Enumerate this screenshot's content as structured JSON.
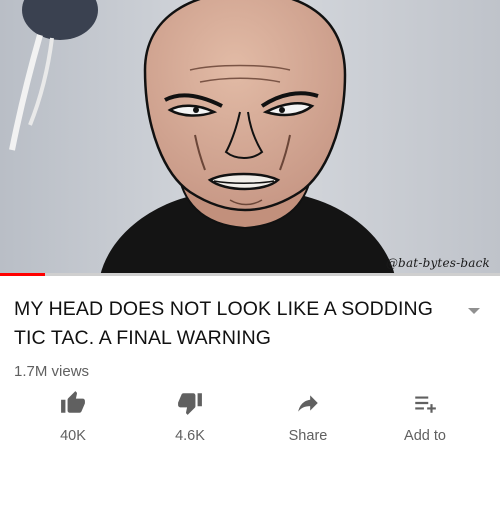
{
  "video": {
    "watermark": "@bat-bytes-back",
    "progress_fraction": 0.09
  },
  "title": "MY HEAD DOES NOT LOOK LIKE A SODDING TIC TAC. A FINAL WARNING",
  "views": "1.7M views",
  "actions": [
    {
      "icon": "thumb-up-icon",
      "label": "40K"
    },
    {
      "icon": "thumb-down-icon",
      "label": "4.6K"
    },
    {
      "icon": "share-icon",
      "label": "Share"
    },
    {
      "icon": "add-to-playlist-icon",
      "label": "Add to"
    }
  ],
  "colors": {
    "progress": "#ff0000",
    "text": "#111111",
    "secondary": "#606060"
  }
}
